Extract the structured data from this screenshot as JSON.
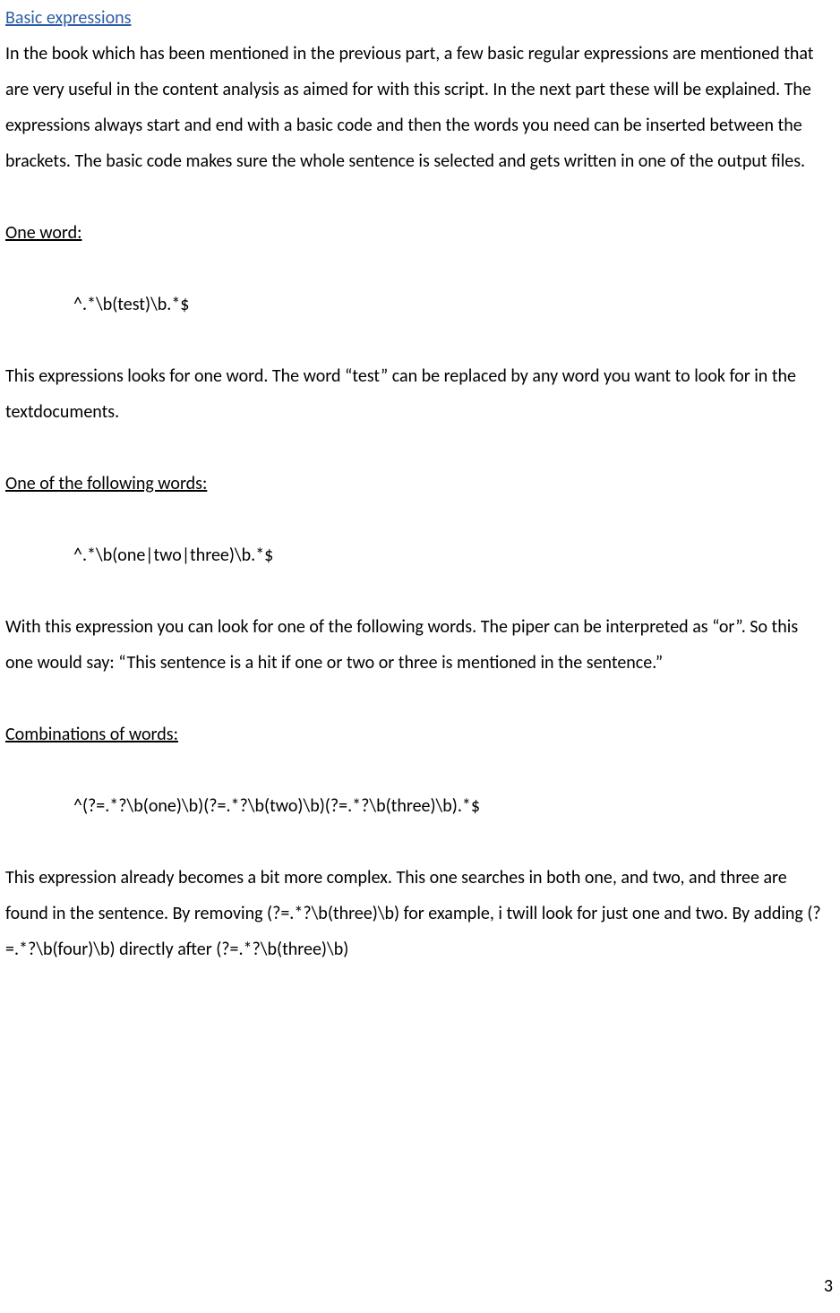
{
  "sections": {
    "basic": {
      "title": "Basic expressions",
      "intro": "In the book which has been mentioned in the previous part, a few basic regular expressions are mentioned that are very useful in the content analysis as aimed for with this script. In the next part these will be explained. The expressions always start and end with a basic code and then the words you need can be inserted between the brackets. The basic code makes sure the whole sentence is selected and gets written in one of the output files."
    },
    "one_word": {
      "title": "One word:",
      "code": "^.*\\b(test)\\b.*$",
      "explain": "This expressions looks for one word. The word “test” can be replaced by any word you want to look for in the textdocuments."
    },
    "one_of": {
      "title": "One of the following words:",
      "code": "^.*\\b(one|two|three)\\b.*$",
      "explain": "With this expression you can look for one of the following words. The piper can be interpreted as “or”. So this one would say: “This sentence is a hit if one or two or three is mentioned in the sentence.”"
    },
    "combos": {
      "title": "Combinations of words:",
      "code": "^(?=.*?\\b(one)\\b)(?=.*?\\b(two)\\b)(?=.*?\\b(three)\\b).*$",
      "explain": "This expression already becomes a bit more complex. This one searches in both one, and two, and three are found in the sentence. By removing (?=.*?\\b(three)\\b) for example, i twill look for just one and two. By adding (?=.*?\\b(four)\\b) directly after (?=.*?\\b(three)\\b)"
    }
  },
  "page_number": "3"
}
